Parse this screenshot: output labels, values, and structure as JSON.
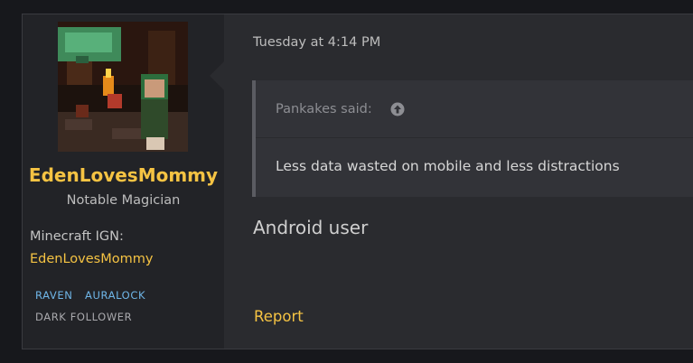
{
  "user": {
    "name": "EdenLovesMommy",
    "title": "Notable Magician",
    "ign_label": "Minecraft IGN:",
    "ign_value": "EdenLovesMommy",
    "badges": [
      {
        "label": "RAVEN",
        "color": "#6fb6e8"
      },
      {
        "label": "AURALOCK",
        "color": "#6fb6e8"
      },
      {
        "label": "DARK FOLLOWER",
        "color": "#a9a9ad"
      }
    ]
  },
  "post": {
    "timestamp": "Tuesday at 4:14 PM",
    "quote": {
      "author": "Pankakes said:",
      "arrow_icon": "arrow-up-circle-icon",
      "text": "Less data wasted on mobile and less distractions"
    },
    "message": "Android user",
    "report_label": "Report"
  },
  "colors": {
    "accent": "#f5c343",
    "badge_blue": "#6fb6e8",
    "panel": "#2a2b2f",
    "sidebar": "#222327"
  }
}
